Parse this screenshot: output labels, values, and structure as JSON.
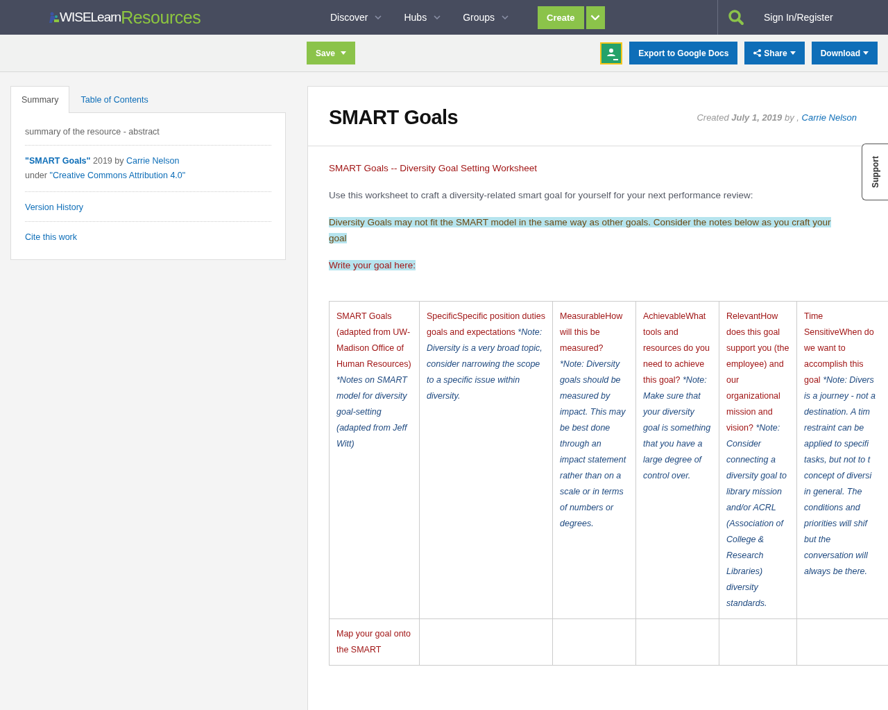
{
  "header": {
    "logo": {
      "first": "WISELearn",
      "second": "Resources"
    },
    "nav": [
      {
        "label": "Discover",
        "dropdown": true
      },
      {
        "label": "Hubs",
        "dropdown": true
      },
      {
        "label": "Groups",
        "dropdown": true
      }
    ],
    "create": {
      "label": "Create"
    },
    "sign_in": "Sign In/Register"
  },
  "toolbar": {
    "save": "Save",
    "export": "Export to Google Docs",
    "share": "Share",
    "download": "Download"
  },
  "sidebar": {
    "tabs": [
      {
        "label": "Summary",
        "selected": true
      },
      {
        "label": "Table of Contents",
        "selected": false
      }
    ],
    "summary": "summary of the resource - abstract",
    "attribution": {
      "title": "\"SMART Goals\"",
      "year_by": "2019 by",
      "author": "Carrie Nelson",
      "under": "under",
      "license": "\"Creative Commons Attribution 4.0\""
    },
    "links": [
      "Version History",
      "Cite this work"
    ]
  },
  "article": {
    "title": "SMART Goals",
    "meta": {
      "created": "Created",
      "date": "July 1, 2019",
      "by": "by ,",
      "author": "Carrie Nelson"
    },
    "paragraphs": [
      {
        "kind": "heading",
        "text": "SMART Goals -- Diversity Goal Setting Worksheet"
      },
      {
        "kind": "body",
        "text": "Use this worksheet to craft a diversity-related smart goal for yourself for your next performance review:"
      },
      {
        "kind": "note",
        "text": " Diversity Goals may not fit the SMART model in the same way as other goals. Consider the notes below as you craft your goal "
      },
      {
        "kind": "prompt",
        "text": " Write your goal here: "
      }
    ],
    "table": {
      "rows": [
        {
          "cells": [
            {
              "main": "SMART Goals (adapted from UW-Madison Office of Human Resources)",
              "note": "*Notes on SMART model for diversity goal-setting (adapted from Jeff Witt)"
            },
            {
              "main": "SpecificSpecific position duties goals and expectations",
              "note": "*Note: Diversity is a very broad topic, consider narrowing the scope to a specific issue within diversity."
            },
            {
              "main": "MeasurableHow will this be measured?",
              "note": "*Note: Diversity goals should be measured by impact. This may be best done through an impact statement rather than on a scale or in terms of numbers or degrees."
            },
            {
              "main": "AchievableWhat tools and resources do you need to achieve this goal?",
              "note": " *Note: Make sure that your diversity goal is something that you have a large degree of control over."
            },
            {
              "main": "RelevantHow does this goal support you (the employee) and our organizational mission and vision?",
              "note": "*Note: Consider connecting a diversity goal to library mission and/or ACRL (Association of College & Research Libraries) diversity standards."
            },
            {
              "main": "Time\nSensitiveWhen do\nwe want to\naccomplish this\ngoal",
              "note": "*Note: Divers\nis a journey - not a\ndestination. A tim\nrestraint can be\napplied to specifi\ntasks, but not to t\nconcept of diversi\nin general. The\nconditions and\npriorities will shif\nbut the\nconversation will\nalways be there."
            }
          ]
        },
        {
          "cells": [
            {
              "main": "Map your goal onto the SMART"
            },
            {},
            {},
            {},
            {},
            {}
          ]
        }
      ]
    }
  },
  "support": "Support"
}
